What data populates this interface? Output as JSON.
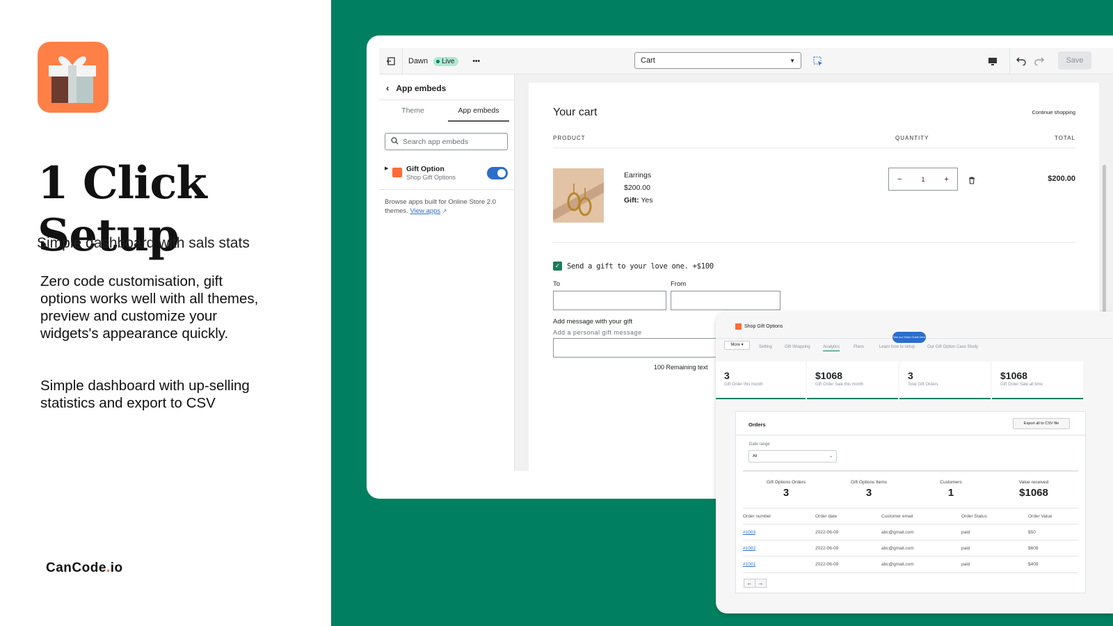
{
  "promo": {
    "title": "1 Click Setup",
    "subtitle": "Simple dashboard with sals stats",
    "para1": "Zero code customisation, gift options works well with all themes, preview and customize your widgets's appearance quickly.",
    "para2": "Simple dashboard with up-selling statistics and export to CSV",
    "brand_main": "CanCode",
    "brand_dot": ".",
    "brand_tld": "io"
  },
  "colors": {
    "brand_green": "#008060",
    "logo_orange": "#ff8047",
    "toggle_blue": "#2c6ecb"
  },
  "editor": {
    "theme_name": "Dawn",
    "live_badge": "Live",
    "more": "•••",
    "page_select": "Cart",
    "save_label": "Save",
    "sidebar": {
      "back_title": "App embeds",
      "tabs": [
        "Theme",
        "App embeds"
      ],
      "search_placeholder": "Search app embeds",
      "embed_name": "Gift Option",
      "embed_sub": "Shop Gift Options",
      "embed_enabled": true,
      "browse_text": "Browse apps built for Online Store 2.0 themes.",
      "view_apps": "View apps"
    },
    "cart": {
      "title": "Your cart",
      "continue": "Continue shopping",
      "col_product": "PRODUCT",
      "col_quantity": "QUANTITY",
      "col_total": "TOTAL",
      "item_name": "Earrings",
      "item_price": "$200.00",
      "gift_label": "Gift:",
      "gift_value": "Yes",
      "qty_minus": "−",
      "qty_value": "1",
      "qty_plus": "+",
      "line_total": "$200.00",
      "gift_checkbox": "Send a gift to your love one. +$100",
      "gift_checked": true,
      "to_label": "To",
      "from_label": "From",
      "message_label": "Add message with your gift",
      "message_placeholder": "Add a personal gift message",
      "remaining": "100 Remaining text"
    }
  },
  "dashboard": {
    "app_name": "Shop Gift Options",
    "more": "More ▾",
    "tabs": [
      "Setting",
      "Gift Wrapping",
      "Analytics",
      "Plans",
      "Learn how to setup",
      "Our Gift Option Case Study"
    ],
    "tooltip": "See our Video Guide here",
    "stats": [
      {
        "value": "3",
        "label": "Gift Order this month"
      },
      {
        "value": "$1068",
        "label": "Gift Order Sale this month"
      },
      {
        "value": "3",
        "label": "Total Gift Orders"
      },
      {
        "value": "$1068",
        "label": "Gift Order Sale all time"
      }
    ],
    "orders": {
      "title": "Orders",
      "export": "Export all to CSV file",
      "date_range_label": "Date range",
      "date_range_value": "All",
      "summary": [
        {
          "label": "Gift Options Orders",
          "value": "3"
        },
        {
          "label": "Gift Options Items",
          "value": "3"
        },
        {
          "label": "Customers",
          "value": "1"
        },
        {
          "label": "Value received",
          "value": "$1068"
        }
      ],
      "columns": [
        "Order number",
        "Order date",
        "Customer email",
        "Order Status",
        "Order Value"
      ],
      "rows": [
        [
          "#1003",
          "2022-06-09",
          "abc@gmail.com",
          "paid",
          "$50"
        ],
        [
          "#1002",
          "2022-06-09",
          "abc@gmail.com",
          "paid",
          "$609"
        ],
        [
          "#1001",
          "2022-06-09",
          "abc@gmail.com",
          "paid",
          "$409"
        ]
      ],
      "prev": "←",
      "next": "→"
    }
  }
}
